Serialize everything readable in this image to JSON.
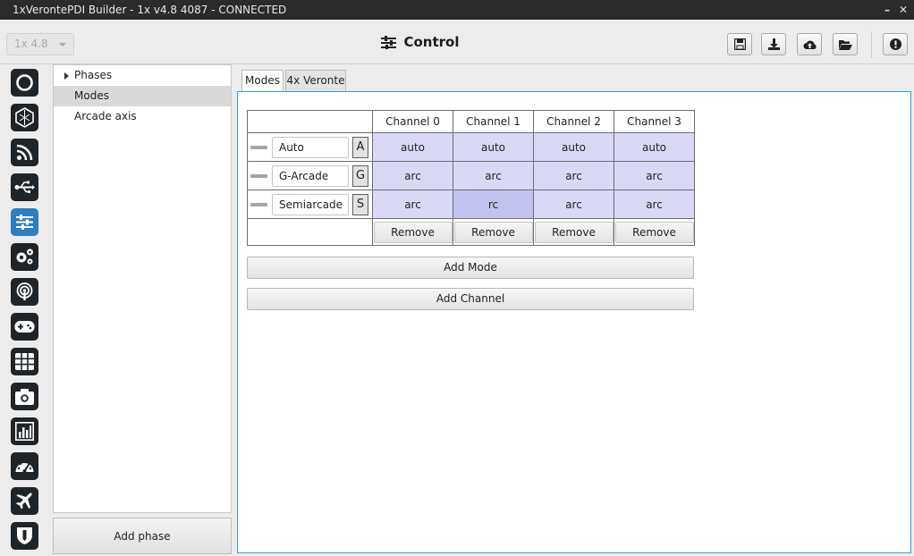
{
  "window": {
    "title": "1xVerontePDI Builder - 1x v4.8 4087 - CONNECTED"
  },
  "toolbar": {
    "version_select": "1x 4.8",
    "heading": "Control",
    "buttons": [
      "save-icon",
      "download-icon",
      "cloud-upload-icon",
      "folder-open-icon",
      "warning-icon"
    ]
  },
  "sidebar": {
    "icons": [
      "power-icon",
      "hexagon-icon",
      "rss-icon",
      "usb-icon",
      "sliders-icon",
      "gears-icon",
      "podcast-icon",
      "gamepad-icon",
      "grid-icon",
      "camera-icon",
      "chart-icon",
      "gauge-icon",
      "airplane-icon",
      "shield-icon"
    ],
    "active_index": 4
  },
  "tree": {
    "items": [
      {
        "label": "Phases",
        "expandable": true
      },
      {
        "label": "Modes",
        "selected": true
      },
      {
        "label": "Arcade axis"
      }
    ],
    "add_phase_label": "Add phase"
  },
  "tabs": [
    {
      "label": "Modes",
      "active": true
    },
    {
      "label": "4x Veronte",
      "active": false
    }
  ],
  "modes_table": {
    "channels": [
      "Channel 0",
      "Channel 1",
      "Channel 2",
      "Channel 3"
    ],
    "rows": [
      {
        "name": "Auto",
        "key": "A",
        "values": [
          "auto",
          "auto",
          "auto",
          "auto"
        ]
      },
      {
        "name": "G-Arcade",
        "key": "G",
        "values": [
          "arc",
          "arc",
          "arc",
          "arc"
        ]
      },
      {
        "name": "Semiarcade",
        "key": "S",
        "values": [
          "arc",
          "rc",
          "arc",
          "arc"
        ]
      }
    ],
    "remove_label": "Remove"
  },
  "actions": {
    "add_mode_label": "Add Mode",
    "add_channel_label": "Add Channel"
  }
}
